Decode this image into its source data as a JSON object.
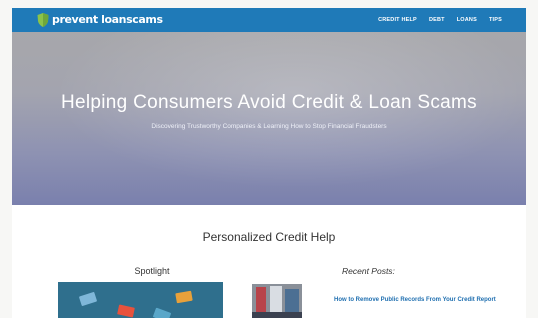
{
  "site": {
    "logo_text": "prevent loanscams"
  },
  "nav": {
    "items": [
      {
        "label": "CREDIT HELP"
      },
      {
        "label": "DEBT"
      },
      {
        "label": "LOANS"
      },
      {
        "label": "TIPS"
      }
    ]
  },
  "hero": {
    "title": "Helping Consumers Avoid Credit & Loan Scams",
    "subtitle": "Discovering Trustworthy Companies & Learning How to Stop Financial Fraudsters"
  },
  "main": {
    "section_title": "Personalized Credit Help",
    "spotlight_heading": "Spotlight",
    "recent_heading": "Recent Posts:",
    "recent_posts": [
      {
        "title": "How to Remove Public Records From Your Credit Report"
      }
    ]
  },
  "colors": {
    "nav_background": "#1f7ab8",
    "logo_shield": "#8bc34a",
    "link": "#1f6fb0"
  },
  "icons": {
    "logo": "shield-icon"
  }
}
